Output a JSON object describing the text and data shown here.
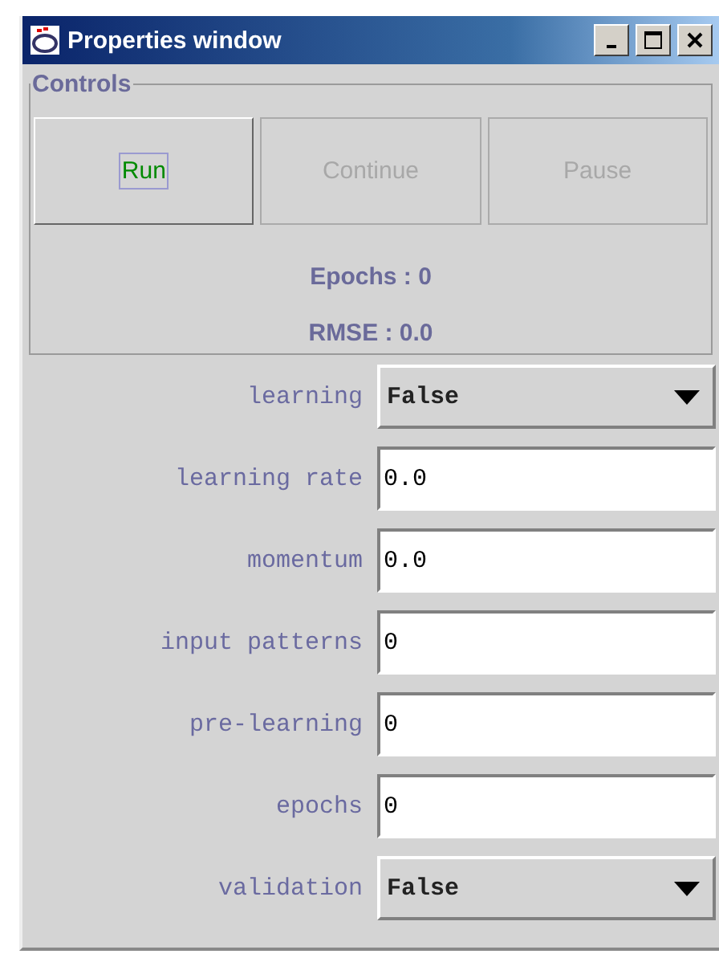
{
  "window": {
    "title": "Properties window"
  },
  "controls": {
    "title": "Controls",
    "buttons": [
      {
        "label": "Run",
        "disabled": false,
        "focused": true
      },
      {
        "label": "Continue",
        "disabled": true,
        "focused": false
      },
      {
        "label": "Pause",
        "disabled": true,
        "focused": false
      }
    ],
    "stats": [
      "Epochs : 0",
      "RMSE : 0.0"
    ]
  },
  "properties": [
    {
      "label": "learning",
      "kind": "select",
      "value": "False"
    },
    {
      "label": "learning rate",
      "kind": "text",
      "value": "0.0"
    },
    {
      "label": "momentum",
      "kind": "text",
      "value": "0.0"
    },
    {
      "label": "input patterns",
      "kind": "text",
      "value": "0"
    },
    {
      "label": "pre-learning",
      "kind": "text",
      "value": "0"
    },
    {
      "label": "epochs",
      "kind": "text",
      "value": "0"
    },
    {
      "label": "validation",
      "kind": "select",
      "value": "False"
    }
  ]
}
